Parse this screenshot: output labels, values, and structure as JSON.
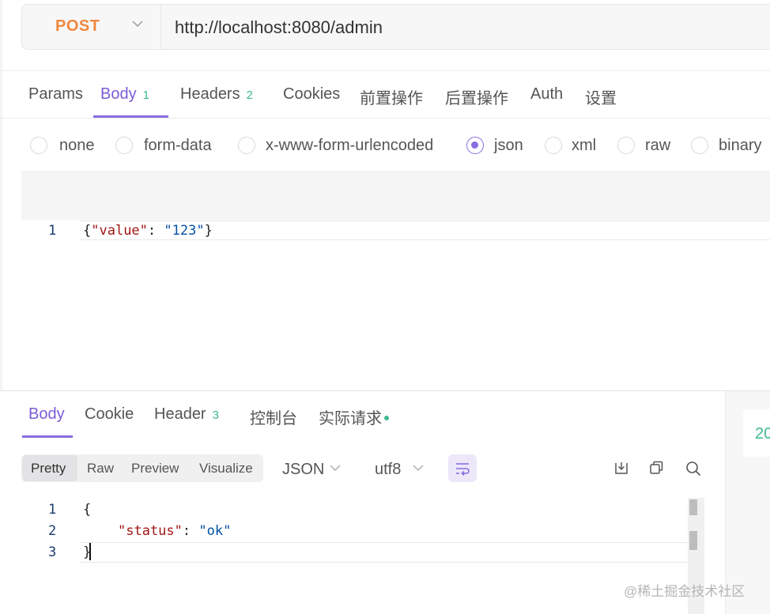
{
  "request": {
    "method": "POST",
    "url": "http://localhost:8080/admin"
  },
  "request_tabs": [
    {
      "label": "Params"
    },
    {
      "label": "Body",
      "badge": "1"
    },
    {
      "label": "Headers",
      "badge": "2"
    },
    {
      "label": "Cookies"
    },
    {
      "label": "前置操作"
    },
    {
      "label": "后置操作"
    },
    {
      "label": "Auth"
    },
    {
      "label": "设置"
    }
  ],
  "body_types": [
    "none",
    "form-data",
    "x-www-form-urlencoded",
    "json",
    "xml",
    "raw",
    "binary"
  ],
  "selected_body_type": "json",
  "request_body": {
    "line_numbers": [
      "1"
    ],
    "line1": {
      "open": "{",
      "key": "\"value\"",
      "colon": ": ",
      "value": "\"123\"",
      "close": "}"
    }
  },
  "response_tabs": [
    {
      "label": "Body"
    },
    {
      "label": "Cookie"
    },
    {
      "label": "Header",
      "badge": "3"
    },
    {
      "label": "控制台"
    },
    {
      "label": "实际请求"
    }
  ],
  "view_modes": [
    "Pretty",
    "Raw",
    "Preview",
    "Visualize"
  ],
  "format": "JSON",
  "encoding": "utf8",
  "response_body": {
    "line_numbers": [
      "1",
      "2",
      "3"
    ],
    "line1": "{",
    "line2": {
      "key": "\"status\"",
      "colon": ": ",
      "value": "\"ok\""
    },
    "line3": "}"
  },
  "status_code_partial": "20",
  "watermark": "@稀土掘金技术社区",
  "colors": {
    "accent": "#8a6de0",
    "method": "#f0883e",
    "badge": "#3cb98b"
  }
}
